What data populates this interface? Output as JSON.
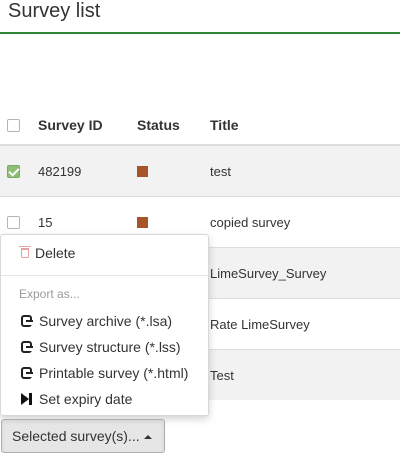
{
  "header": {
    "title": "Survey list"
  },
  "table": {
    "columns": [
      "Survey ID",
      "Status",
      "Title"
    ],
    "rows": [
      {
        "checked": true,
        "id": "482199",
        "status_color": "#a8542a",
        "title": "test"
      },
      {
        "checked": false,
        "id": "15",
        "status_color": "#a8542a",
        "title": "copied survey"
      },
      {
        "title": "LimeSurvey_Survey"
      },
      {
        "title": "Rate LimeSurvey"
      },
      {
        "title": "Test"
      }
    ]
  },
  "menu": {
    "delete_label": "Delete",
    "export_header": "Export as...",
    "export_items": [
      "Survey archive (*.lsa)",
      "Survey structure (*.lss)",
      "Printable survey (*.html)"
    ],
    "expiry_label": "Set expiry date"
  },
  "actions": {
    "selected_label": "Selected survey(s)..."
  },
  "colors": {
    "accent_green": "#328637",
    "status_inactive": "#a8542a",
    "checkbox_checked": "#8cbf72"
  }
}
